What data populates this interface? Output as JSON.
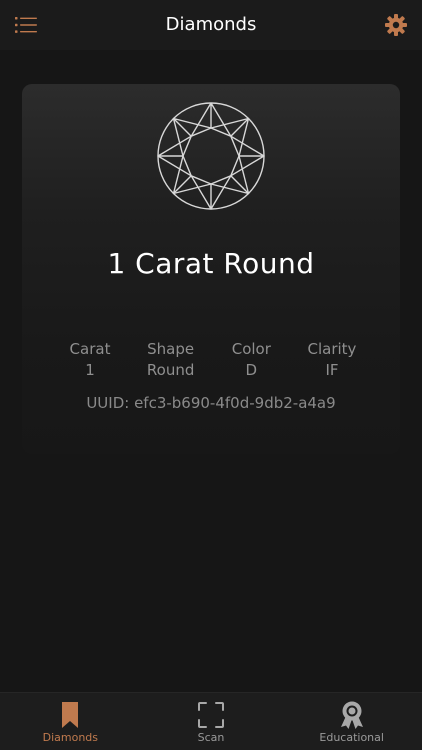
{
  "colors": {
    "accent": "#c07a4e",
    "background": "#161616",
    "header": "#1b1b1b",
    "muted_text": "#8f8f8f"
  },
  "header": {
    "title": "Diamonds",
    "menu_icon": "list-icon",
    "settings_icon": "gear-icon"
  },
  "diamond": {
    "image_icon": "round-diamond-icon",
    "name": "1 Carat Round",
    "specs": [
      {
        "label": "Carat",
        "value": "1"
      },
      {
        "label": "Shape",
        "value": "Round"
      },
      {
        "label": "Color",
        "value": "D"
      },
      {
        "label": "Clarity",
        "value": "IF"
      }
    ],
    "uuid": "UUID: efc3-b690-4f0d-9db2-a4a9"
  },
  "tabbar": {
    "active_tab": "Diamonds",
    "tabs": [
      {
        "label": "Diamonds",
        "icon": "bookmark-icon"
      },
      {
        "label": "Scan",
        "icon": "scan-frame-icon"
      },
      {
        "label": "Educational",
        "icon": "award-ribbon-icon"
      }
    ]
  }
}
